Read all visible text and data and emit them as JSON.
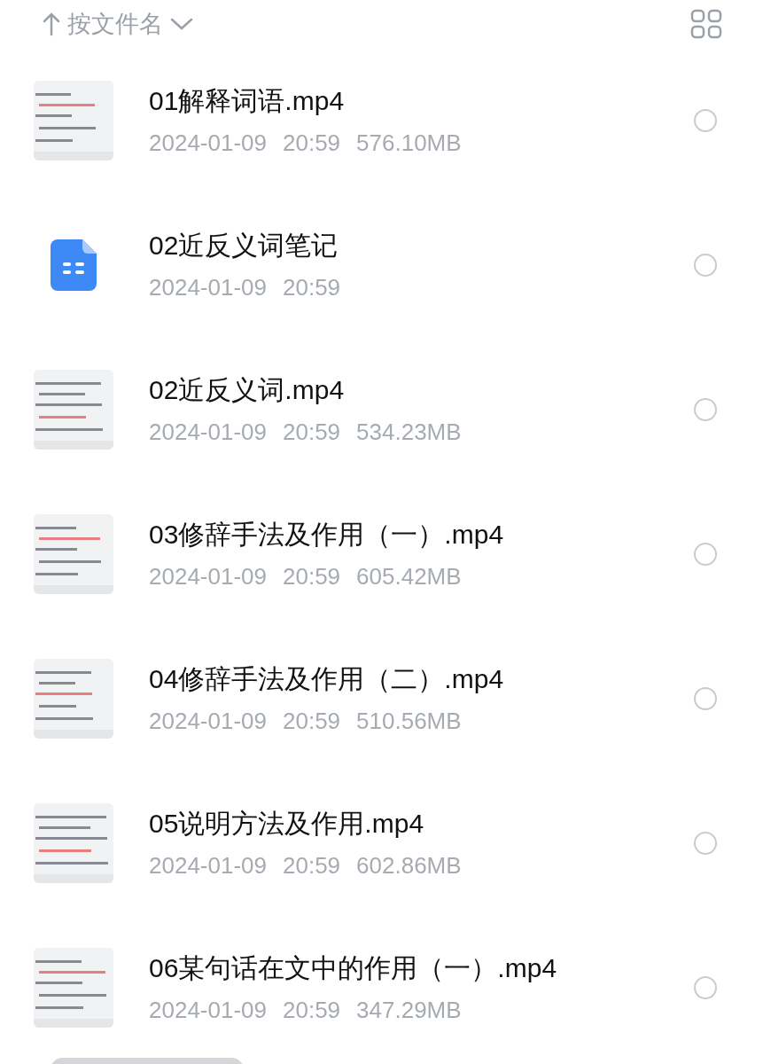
{
  "toolbar": {
    "sort_label": "按文件名"
  },
  "files": [
    {
      "kind": "video",
      "name": "01解释词语.mp4",
      "date": "2024-01-09",
      "time": "20:59",
      "size": "576.10MB",
      "selected": false
    },
    {
      "kind": "note",
      "name": "02近反义词笔记",
      "date": "2024-01-09",
      "time": "20:59",
      "selected": false
    },
    {
      "kind": "video",
      "name": "02近反义词.mp4",
      "date": "2024-01-09",
      "time": "20:59",
      "size": "534.23MB",
      "selected": false
    },
    {
      "kind": "video",
      "name": "03修辞手法及作用（一）.mp4",
      "date": "2024-01-09",
      "time": "20:59",
      "size": "605.42MB",
      "selected": false
    },
    {
      "kind": "video",
      "name": "04修辞手法及作用（二）.mp4",
      "date": "2024-01-09",
      "time": "20:59",
      "size": "510.56MB",
      "selected": false
    },
    {
      "kind": "video",
      "name": "05说明方法及作用.mp4",
      "date": "2024-01-09",
      "time": "20:59",
      "size": "602.86MB",
      "selected": false
    },
    {
      "kind": "video",
      "name": "06某句话在文中的作用（一）.mp4",
      "date": "2024-01-09",
      "time": "20:59",
      "size": "347.29MB",
      "selected": false
    }
  ]
}
